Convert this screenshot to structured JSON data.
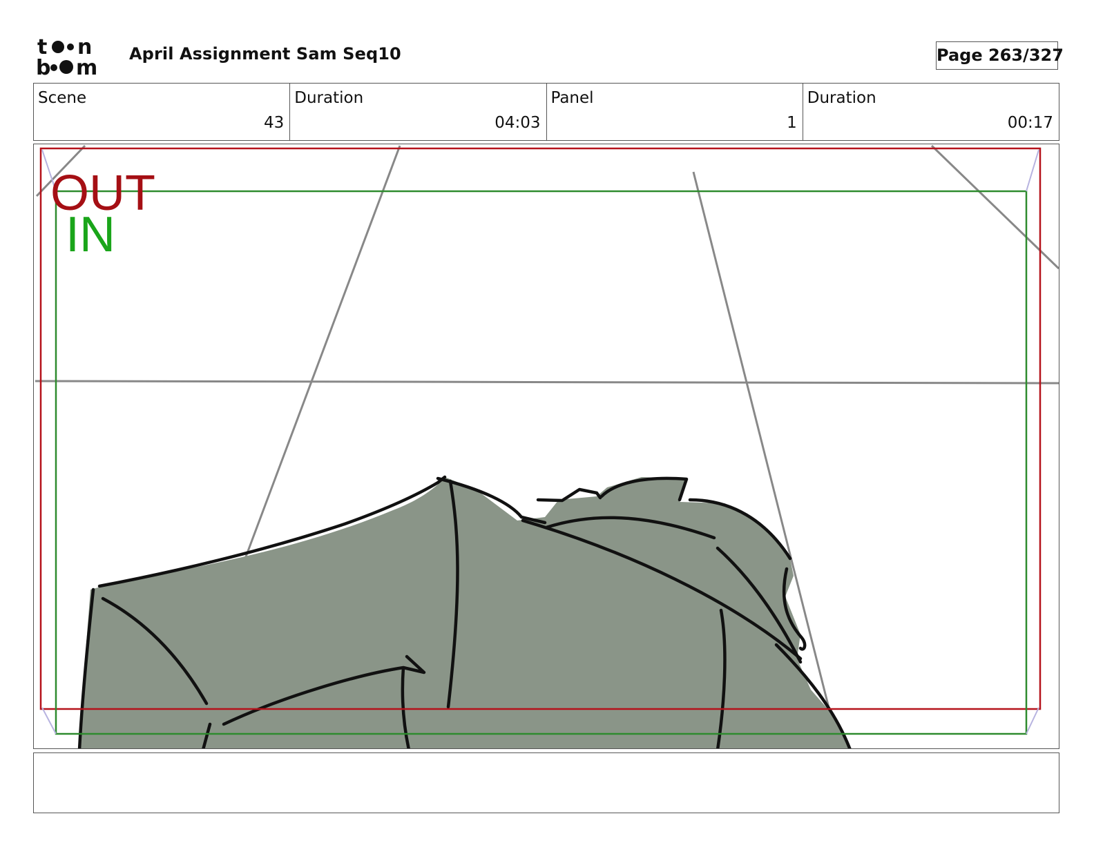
{
  "header": {
    "logo_text": "toon boom",
    "title": "April Assignment Sam Seq10",
    "page": "Page 263/327"
  },
  "info": {
    "scene_label": "Scene",
    "scene_value": "43",
    "scene_duration_label": "Duration",
    "scene_duration_value": "04:03",
    "panel_label": "Panel",
    "panel_value": "1",
    "panel_duration_label": "Duration",
    "panel_duration_value": "00:17"
  },
  "panel": {
    "out_label": "OUT",
    "in_label": "IN",
    "out_color": "#a50f14",
    "in_color": "#1aa51a",
    "figure_fill": "#8a9588",
    "perspective_line_color": "#888888"
  },
  "caption": {
    "text": ""
  }
}
